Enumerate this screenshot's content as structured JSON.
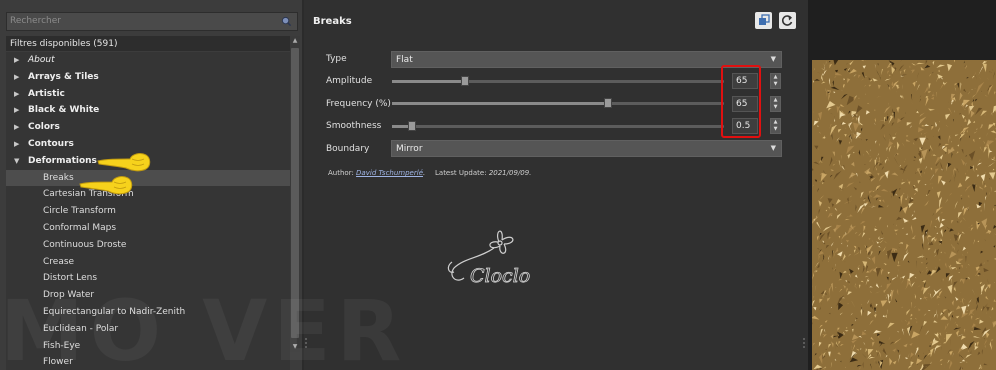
{
  "search": {
    "placeholder": "Rechercher"
  },
  "filters": {
    "header": "Filtres disponibles (591)",
    "tree": [
      {
        "label": "About",
        "type": "cat",
        "italic": true,
        "expanded": false
      },
      {
        "label": "Arrays & Tiles",
        "type": "cat",
        "expanded": false
      },
      {
        "label": "Artistic",
        "type": "cat",
        "expanded": false
      },
      {
        "label": "Black & White",
        "type": "cat",
        "expanded": false
      },
      {
        "label": "Colors",
        "type": "cat",
        "expanded": false
      },
      {
        "label": "Contours",
        "type": "cat",
        "expanded": false
      },
      {
        "label": "Deformations",
        "type": "cat",
        "expanded": true
      },
      {
        "label": "Breaks",
        "type": "sub",
        "selected": true
      },
      {
        "label": "Cartesian Transform",
        "type": "sub"
      },
      {
        "label": "Circle Transform",
        "type": "sub"
      },
      {
        "label": "Conformal Maps",
        "type": "sub"
      },
      {
        "label": "Continuous Droste",
        "type": "sub"
      },
      {
        "label": "Crease",
        "type": "sub"
      },
      {
        "label": "Distort Lens",
        "type": "sub"
      },
      {
        "label": "Drop Water",
        "type": "sub"
      },
      {
        "label": "Equirectangular to Nadir-Zenith",
        "type": "sub"
      },
      {
        "label": "Euclidean - Polar",
        "type": "sub"
      },
      {
        "label": "Fish-Eye",
        "type": "sub"
      },
      {
        "label": "Flower",
        "type": "sub"
      }
    ]
  },
  "filter": {
    "title": "Breaks",
    "type": {
      "label": "Type",
      "value": "Flat"
    },
    "amplitude": {
      "label": "Amplitude",
      "value": "65",
      "level": 0.22
    },
    "frequency": {
      "label": "Frequency (%)",
      "value": "65",
      "level": 0.65
    },
    "smoothness": {
      "label": "Smoothness",
      "value": "0.5",
      "level": 0.06
    },
    "boundary": {
      "label": "Boundary",
      "value": "Mirror"
    },
    "author_label": "Author:",
    "author_name": "David Tschumperlé",
    "author_suffix": ".",
    "update_label": "Latest Update:",
    "update_value": "2021/09/09",
    "update_suffix": "."
  },
  "signature": {
    "text": "Cloclo"
  },
  "watermark": {
    "text": "MO VER"
  },
  "colors": {
    "highlight": "#e01010",
    "pointer": "#f6d21c",
    "preview_base": "#8e6f3a"
  },
  "icons": {
    "search": "search-icon",
    "copy": "copy-icon",
    "refresh": "refresh-icon"
  }
}
